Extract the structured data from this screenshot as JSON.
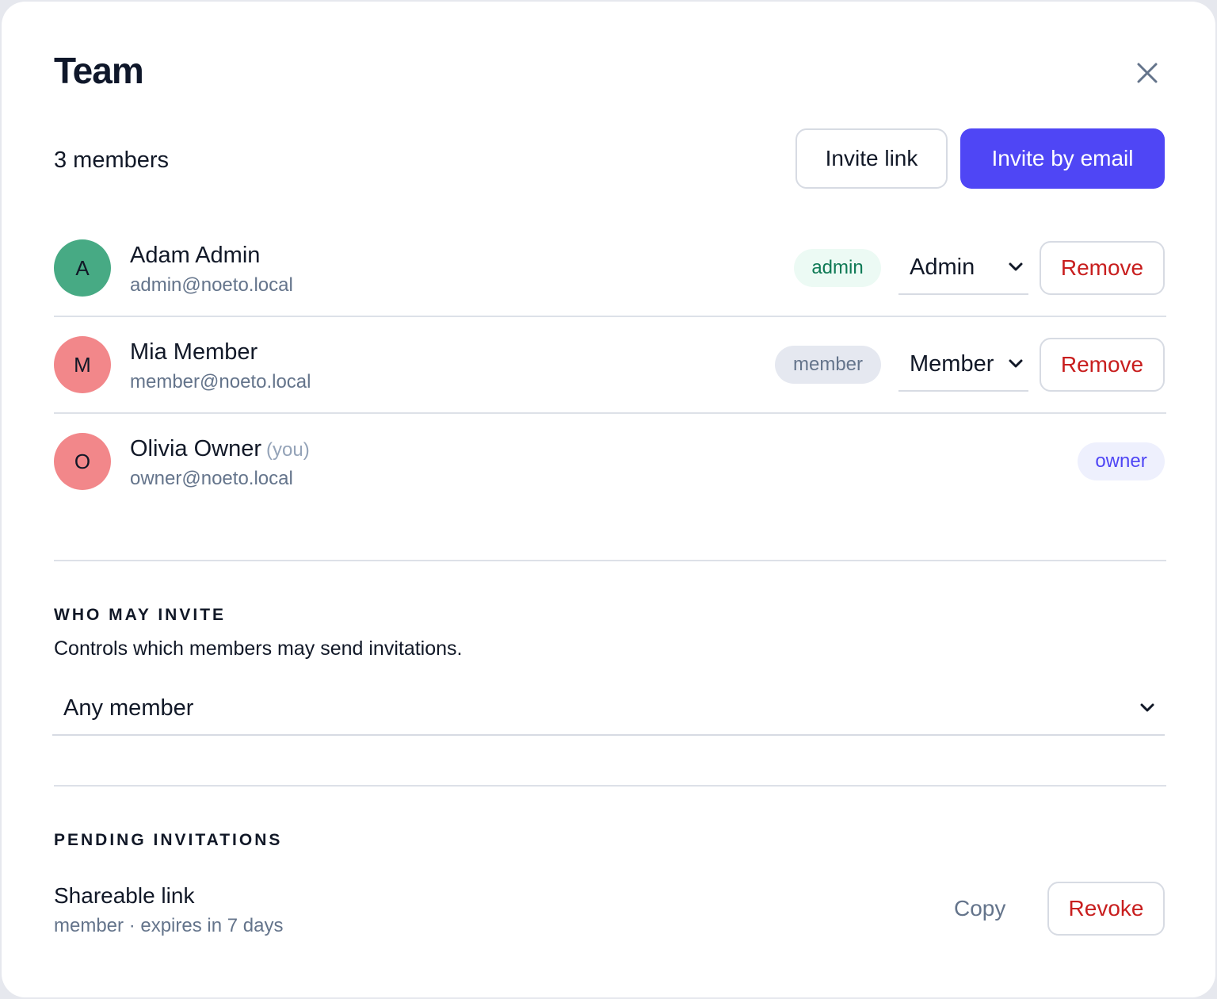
{
  "modal": {
    "title": "Team",
    "close_icon": "close-icon"
  },
  "header": {
    "member_count": "3 members",
    "invite_link_label": "Invite link",
    "invite_email_label": "Invite by email"
  },
  "members": [
    {
      "initial": "A",
      "name": "Adam Admin",
      "you_label": "",
      "email": "admin@noeto.local",
      "badge": "admin",
      "role_select": "Admin",
      "remove_label": "Remove",
      "avatar_color": "#47aa84"
    },
    {
      "initial": "M",
      "name": "Mia Member",
      "you_label": "",
      "email": "member@noeto.local",
      "badge": "member",
      "role_select": "Member",
      "remove_label": "Remove",
      "avatar_color": "#f2878a"
    },
    {
      "initial": "O",
      "name": "Olivia Owner",
      "you_label": "(you)",
      "email": "owner@noeto.local",
      "badge": "owner",
      "avatar_color": "#f2878a"
    }
  ],
  "who_may_invite": {
    "heading": "WHO MAY INVITE",
    "description": "Controls which members may send invitations.",
    "selected": "Any member"
  },
  "pending": {
    "heading": "PENDING INVITATIONS",
    "item_title": "Shareable link",
    "item_meta": "member · expires in 7 days",
    "copy_label": "Copy",
    "revoke_label": "Revoke"
  },
  "colors": {
    "primary": "#4f46f5",
    "danger": "#c81e1e",
    "admin_badge_bg": "#ecfaf4",
    "admin_badge_text": "#0f7a55",
    "member_badge_bg": "#e5e8f0",
    "member_badge_text": "#64748b",
    "owner_badge_bg": "#eef0fd",
    "owner_badge_text": "#4f46f5"
  }
}
